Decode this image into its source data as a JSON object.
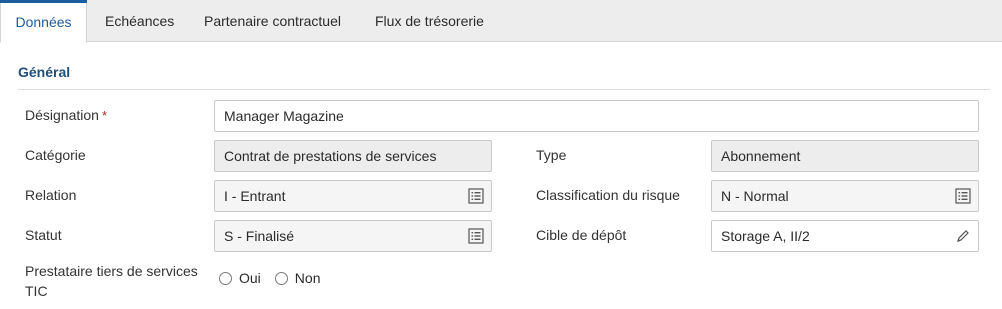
{
  "tabs": [
    {
      "label": "Données",
      "active": true
    },
    {
      "label": "Echéances",
      "active": false
    },
    {
      "label": "Partenaire contractuel",
      "active": false
    },
    {
      "label": "Flux de trésorerie",
      "active": false
    }
  ],
  "section": {
    "title": "Général"
  },
  "fields": {
    "designation": {
      "label": "Désignation",
      "required_mark": "*",
      "value": "Manager Magazine"
    },
    "categorie": {
      "label": "Catégorie",
      "value": "Contrat de prestations de services"
    },
    "type": {
      "label": "Type",
      "value": "Abonnement"
    },
    "relation": {
      "label": "Relation",
      "value": "I - Entrant"
    },
    "classification": {
      "label": "Classification du risque",
      "value": "N - Normal"
    },
    "statut": {
      "label": "Statut",
      "value": "S - Finalisé"
    },
    "cible": {
      "label": "Cible de dépôt",
      "value": "Storage A, II/2"
    },
    "prestataire": {
      "label_line1": "Prestataire tiers de services",
      "label_line2": "TIC",
      "options": [
        "Oui",
        "Non"
      ]
    }
  },
  "icons": {
    "picklist": "list-icon",
    "edit": "pencil-icon"
  },
  "colors": {
    "accent": "#1b5ea0",
    "section_title": "#1f4e78",
    "required": "#b0282e"
  }
}
